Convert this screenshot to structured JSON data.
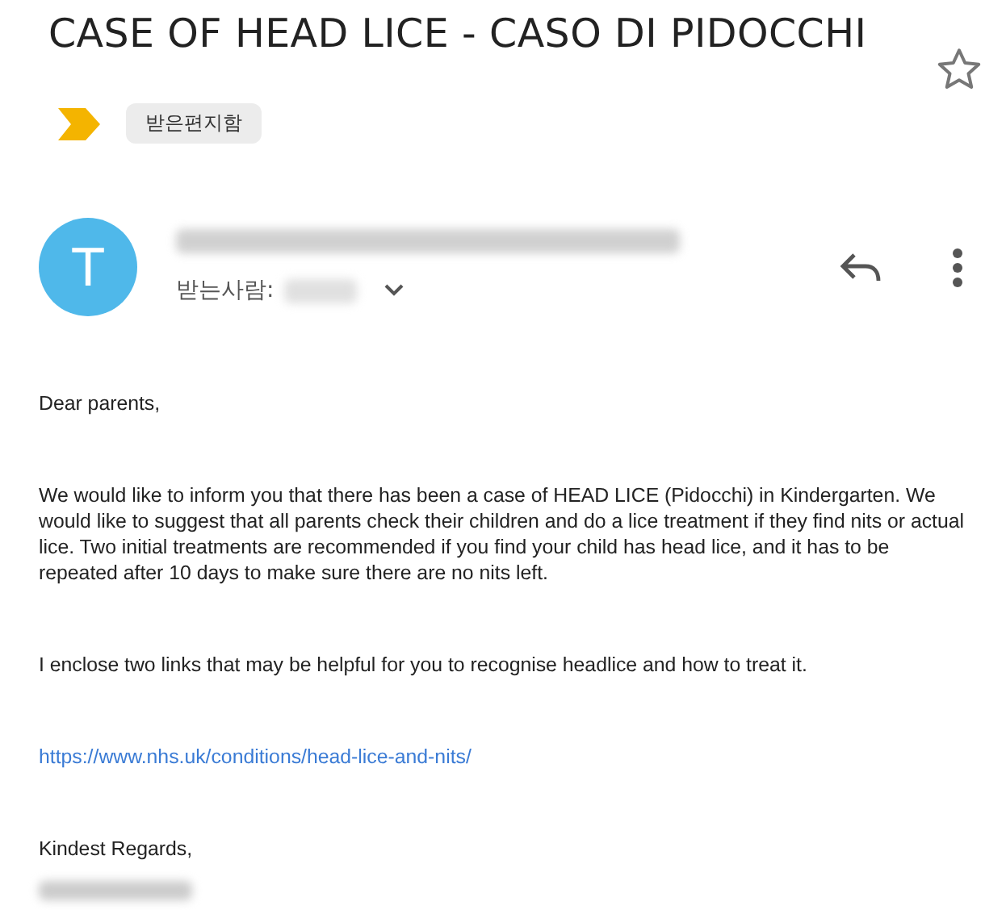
{
  "subject": "CASE OF HEAD LICE - CASO DI PIDOCCHI",
  "important": true,
  "starred": false,
  "labels": [
    "받은편지함"
  ],
  "sender": {
    "avatar_letter": "T",
    "to_label": "받는사람:"
  },
  "body": [
    {
      "kind": "text",
      "text": "Dear parents,"
    },
    {
      "kind": "text",
      "text": "We would like to inform you that there has been a case of HEAD LICE (Pidocchi) in Kindergarten. We would like to suggest that all parents check their children and do a lice treatment if they find nits or actual lice. Two initial treatments are recommended if you find your child has head lice, and it has to be repeated after 10 days to make sure there are no nits left."
    },
    {
      "kind": "text",
      "text": "I enclose two links that may be helpful for you to recognise headlice and how to treat it."
    },
    {
      "kind": "link",
      "text": "https://www.nhs.uk/conditions/head-lice-and-nits/"
    },
    {
      "kind": "text",
      "text": "Kindest Regards,"
    }
  ]
}
